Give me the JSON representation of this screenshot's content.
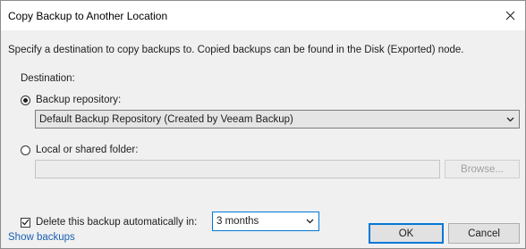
{
  "window": {
    "title": "Copy Backup to Another Location",
    "close_icon": "close-icon"
  },
  "description": "Specify a destination to copy backups to. Copied backups can be found in the Disk (Exported) node.",
  "destination": {
    "label": "Destination:",
    "repository_option": {
      "label": "Backup repository:",
      "selected": true,
      "combo_value": "Default Backup Repository (Created by Veeam Backup)"
    },
    "folder_option": {
      "label": "Local or shared folder:",
      "selected": false,
      "path_value": "",
      "browse_label": "Browse..."
    }
  },
  "retention": {
    "checkbox_label": "Delete this backup automatically in:",
    "checked": true,
    "selected_value": "3 months"
  },
  "footer": {
    "link_label": "Show backups",
    "ok_label": "OK",
    "cancel_label": "Cancel"
  }
}
